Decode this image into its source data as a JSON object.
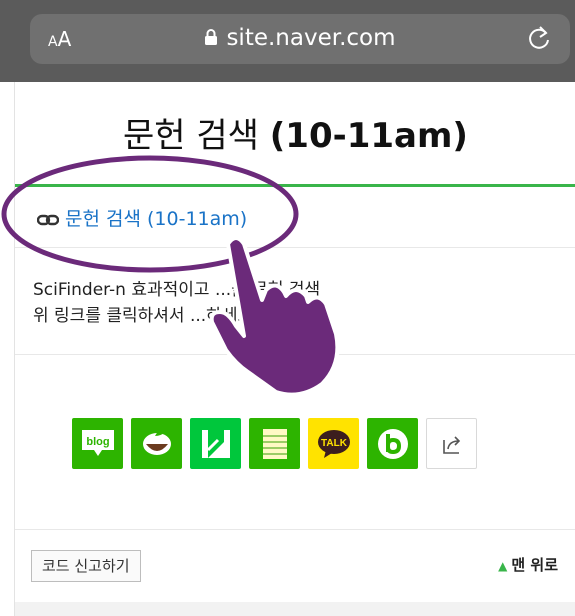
{
  "browser": {
    "text_size_label_small": "A",
    "text_size_label_large": "A",
    "url": "site.naver.com",
    "lock_icon": "lock-icon",
    "reload_icon": "reload-icon"
  },
  "page": {
    "title_korean": "문헌 검색",
    "title_time": "(10-11am)",
    "link_text": "문헌 검색 (10-11am)",
    "link_icon": "chain-link-icon",
    "description_line1": "SciFinder-n 효과적이고 ...을 문헌 검색",
    "description_line2": "위 링크를 클릭하셔서 ...하세요.",
    "share_buttons": [
      {
        "name": "blog",
        "label": "blog",
        "color": "#2db400"
      },
      {
        "name": "cafe",
        "label": "",
        "color": "#2db400"
      },
      {
        "name": "keep",
        "label": "",
        "color": "#00c73c"
      },
      {
        "name": "memo",
        "label": "",
        "color": "#2db400"
      },
      {
        "name": "kakaotalk",
        "label": "TALK",
        "color": "#ffe300"
      },
      {
        "name": "band",
        "label": "",
        "color": "#2db400"
      },
      {
        "name": "share",
        "label": "",
        "color": "#ffffff"
      }
    ],
    "report_button": "코드 신고하기",
    "to_top": "맨 위로"
  },
  "colors": {
    "accent_green": "#39b54a",
    "link_blue": "#1a73c7",
    "annotation_purple": "#6b2a7a"
  }
}
